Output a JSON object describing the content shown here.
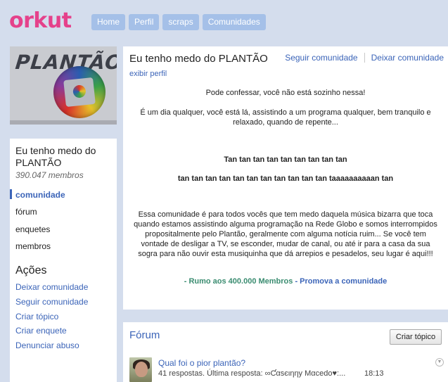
{
  "header": {
    "logo": "orkut",
    "nav": [
      "Home",
      "Perfil",
      "scraps",
      "Comunidades"
    ]
  },
  "sidebar": {
    "cover_text": "PLANTÃO",
    "community_name": "Eu tenho medo do PLANTÃO",
    "members": "390.047 membros",
    "menu": [
      "comunidade",
      "fórum",
      "enquetes",
      "membros"
    ],
    "acoes_title": "Ações",
    "acoes": [
      "Deixar comunidade",
      "Seguir comunidade",
      "Criar tópico",
      "Criar enquete",
      "Denunciar abuso"
    ]
  },
  "main": {
    "title": "Eu tenho medo do PLANTÃO",
    "follow_label": "Seguir comunidade",
    "leave_label": "Deixar comunidade",
    "profile_link": "exibir perfil",
    "desc_1": "Pode confessar, você não está sozinho nessa!",
    "desc_2a": "É um dia qualquer, você está lá, assistindo a um programa qualquer, bem tranquilo e",
    "desc_2b": "relaxado, quando de repente...",
    "tan_1": "Tan tan tan tan tan tan tan tan tan",
    "tan_2": "tan tan tan tan tan tan tan tan tan tan tan taaaaaaaaaan tan",
    "desc_3a": "Essa comunidade é para todos vocês que tem medo daquela música bizarra que toca",
    "desc_3b": "quando estamos assistindo alguma programação na Rede Globo e somos interrompidos",
    "desc_3c": "propositalmente pelo Plantão, geralmente com alguma notícia ruim... Se você tem",
    "desc_3d": "vontade de desligar a TV, se esconder, mudar de canal, ou até ir para a casa da sua",
    "desc_3e": "sogra para não ouvir esta musiquinha que dá arrepios e pesadelos, seu lugar é aqui!!!",
    "rumo": "- Rumo aos 400.000 Membros",
    "promova": "- Promova a comunidade"
  },
  "forum": {
    "title": "Fórum",
    "create_button": "Criar tópico",
    "topic": {
      "title": "Qual foi o pior plantão?",
      "meta": "41 respostas.  Última resposta: ∞Ƈαѕєιηηу Mαcedo♥:...",
      "time": "18:13"
    }
  },
  "colors": {
    "background": "#d4dded",
    "logo": "#e5418b",
    "nav_button": "#a5c0e8",
    "link": "#3b64b8",
    "green_link": "#3a8c70"
  },
  "icons": {
    "topic_dropdown": "chevron-down-icon",
    "avatar": "user-avatar"
  }
}
